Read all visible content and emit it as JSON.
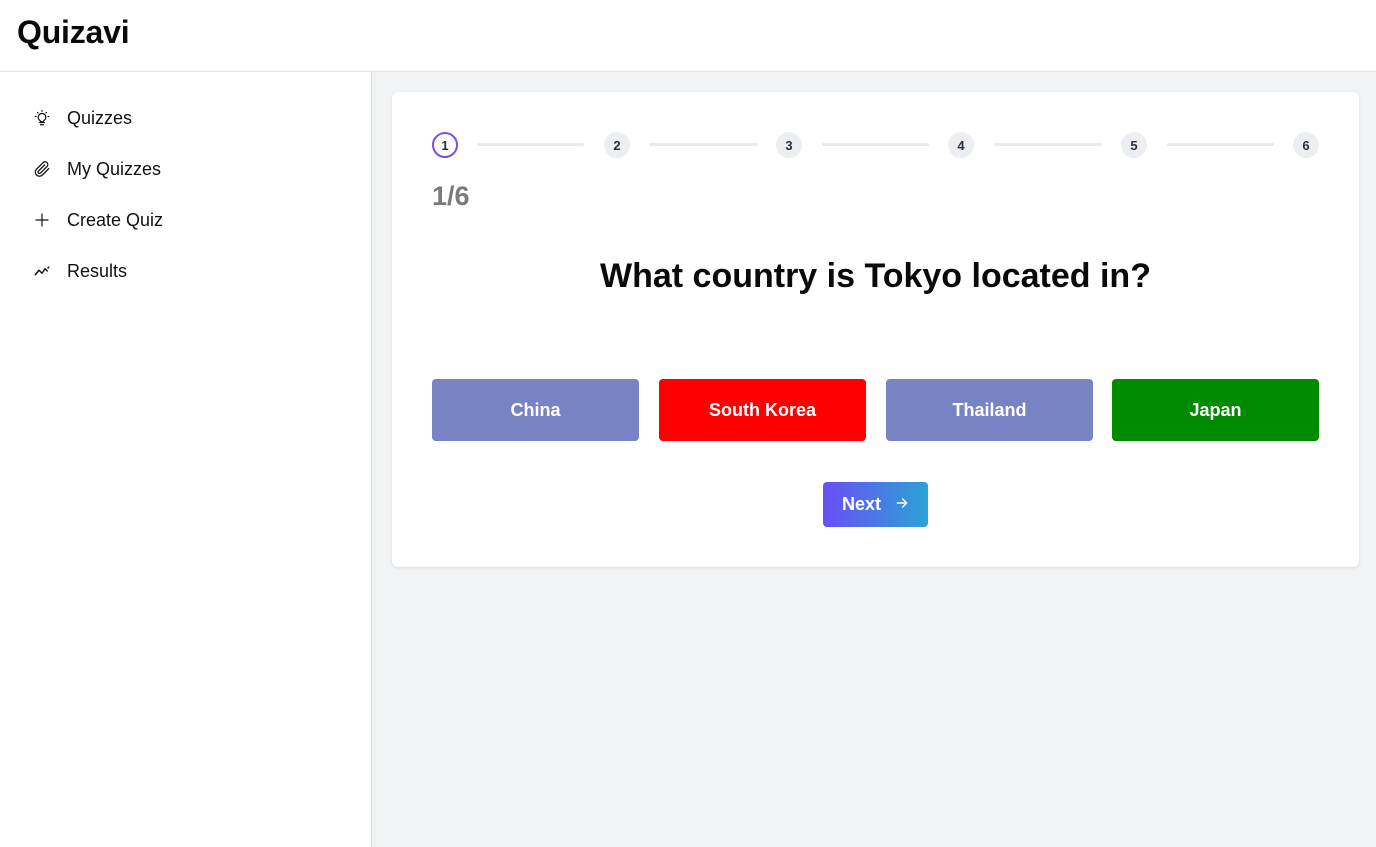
{
  "app": {
    "title": "Quizavi"
  },
  "sidebar": {
    "items": [
      {
        "label": "Quizzes",
        "icon": "lightbulb-icon"
      },
      {
        "label": "My Quizzes",
        "icon": "paperclip-icon"
      },
      {
        "label": "Create Quiz",
        "icon": "plus-icon"
      },
      {
        "label": "Results",
        "icon": "trend-line-icon"
      }
    ]
  },
  "quiz": {
    "steps": [
      "1",
      "2",
      "3",
      "4",
      "5",
      "6"
    ],
    "current_step": "1",
    "progress_text": "1/6",
    "question": "What country is Tokyo located in?",
    "answers": [
      {
        "label": "China",
        "color": "#7783c3",
        "state": "neutral"
      },
      {
        "label": "South Korea",
        "color": "#ff0000",
        "state": "incorrect"
      },
      {
        "label": "Thailand",
        "color": "#7783c3",
        "state": "neutral"
      },
      {
        "label": "Japan",
        "color": "#008a00",
        "state": "correct"
      }
    ],
    "next_label": "Next",
    "next_icon": "arrow-right-icon"
  },
  "colors": {
    "active_step_ring": "#7a4ee8",
    "next_gradient_start": "#6a4ef6",
    "next_gradient_end": "#2aa3d6"
  }
}
